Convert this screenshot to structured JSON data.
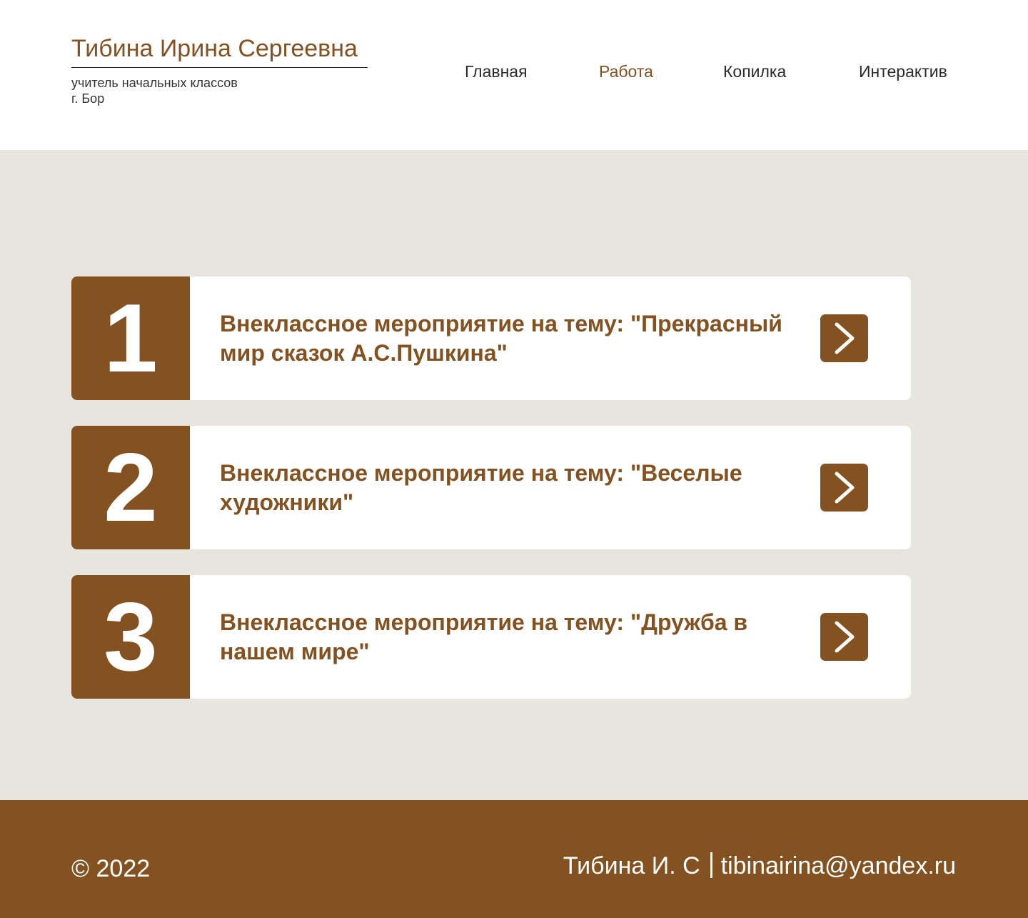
{
  "brand": {
    "name": "Тибина Ирина Сергеевна",
    "subtitle_line1": "учитель начальных классов",
    "subtitle_line2": "г. Бор"
  },
  "nav": {
    "items": [
      {
        "label": "Главная",
        "active": false
      },
      {
        "label": "Работа",
        "active": true
      },
      {
        "label": "Копилка",
        "active": false
      },
      {
        "label": "Интерактив",
        "active": false
      }
    ]
  },
  "works": [
    {
      "number": "1",
      "title": "Внеклассное мероприятие на тему: \"Прекрасный мир сказок А.С.Пушкина\"",
      "arrow_icon": "chevron-right-icon"
    },
    {
      "number": "2",
      "title": "Внеклассное мероприятие на тему: \"Веселые художники\"",
      "arrow_icon": "chevron-right-icon"
    },
    {
      "number": "3",
      "title": "Внеклассное мероприятие на тему: \"Дружба в нашем мире\"",
      "arrow_icon": "chevron-right-icon"
    }
  ],
  "footer": {
    "copyright": "© 2022",
    "author": "Тибина И. С",
    "email": "tibinairina@yandex.ru"
  },
  "colors": {
    "accent": "#845221",
    "page_background": "#e8e5df",
    "card_background": "#ffffff",
    "nav_text": "#2b2b2b"
  }
}
